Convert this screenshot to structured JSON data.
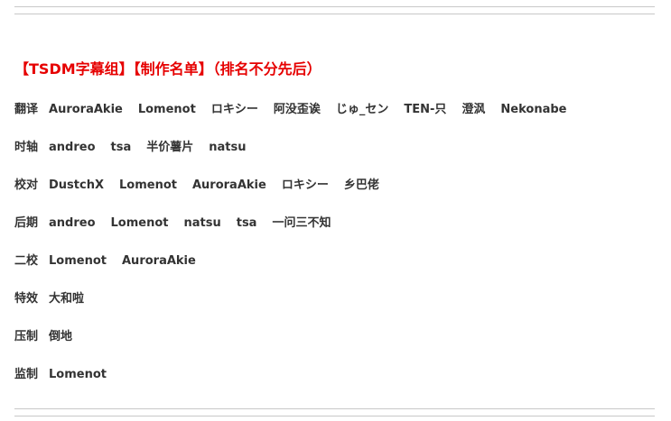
{
  "title": "【TSDM字幕组】【制作名单】（排名不分先后）",
  "credits": [
    {
      "role": "翻译",
      "names": [
        "AuroraAkie",
        "Lomenot",
        "ロキシー",
        "阿没歪诶",
        "じゅ_セン",
        "TEN-只",
        "澄沨",
        "Nekonabe"
      ]
    },
    {
      "role": "时轴",
      "names": [
        "andreo",
        "tsa",
        "半价薯片",
        "natsu"
      ]
    },
    {
      "role": "校对",
      "names": [
        "DustchX",
        "Lomenot",
        "AuroraAkie",
        "ロキシー",
        "乡巴佬"
      ]
    },
    {
      "role": "后期",
      "names": [
        "andreo",
        "Lomenot",
        "natsu",
        "tsa",
        "一问三不知"
      ]
    },
    {
      "role": "二校",
      "names": [
        "Lomenot",
        "AuroraAkie"
      ]
    },
    {
      "role": "特效",
      "names": [
        "大和啦"
      ]
    },
    {
      "role": "压制",
      "names": [
        "倒地"
      ]
    },
    {
      "role": "监制",
      "names": [
        "Lomenot"
      ]
    }
  ]
}
